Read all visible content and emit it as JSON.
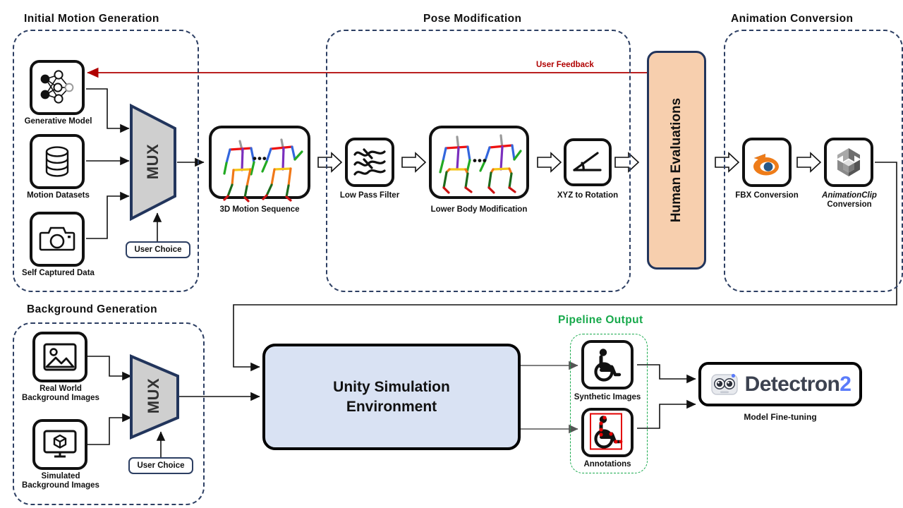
{
  "figure": {
    "title": "Synthetic wheelchair motion data generation pipeline",
    "sections": [
      {
        "id": "initial-motion-generation",
        "label": "Initial Motion Generation"
      },
      {
        "id": "pose-modification",
        "label": "Pose Modification"
      },
      {
        "id": "animation-conversion",
        "label": "Animation  Conversion"
      },
      {
        "id": "background-generation",
        "label": "Background  Generation"
      },
      {
        "id": "pipeline-output",
        "label": "Pipeline Output"
      }
    ],
    "colors": {
      "section_border": "#2d3f63",
      "pipeline_output": "#17a94b",
      "human_eval_fill": "#f7cfae",
      "human_eval_border": "#22355c",
      "unity_fill": "#d9e2f3",
      "feedback_arrow": "#b00000",
      "mux_fill": "#cfcfcf",
      "mux_border": "#22355c",
      "detectron_blue": "#5b7cfa",
      "annotation_box": "#e30000"
    }
  },
  "initial_motion": {
    "title": "Initial Motion Generation",
    "sources": [
      {
        "icon": "neural-network-icon",
        "label": "Generative Model"
      },
      {
        "icon": "database-icon",
        "label": "Motion Datasets"
      },
      {
        "icon": "camera-icon",
        "label": "Self Captured Data"
      }
    ],
    "mux_label": "MUX",
    "user_choice": "User Choice"
  },
  "motion_sequence": {
    "icon": "skeleton-sequence-icon",
    "label": "3D Motion Sequence",
    "ellipsis": "•••"
  },
  "pose_modification": {
    "title": "Pose Modification",
    "steps": [
      {
        "icon": "low-pass-filter-icon",
        "label": "Low Pass Filter"
      },
      {
        "icon": "skeleton-sequence-icon",
        "label": "Lower Body Modification",
        "ellipsis": "•••"
      },
      {
        "icon": "angle-icon",
        "label": "XYZ to Rotation"
      }
    ]
  },
  "human_evaluations": {
    "label": "Human Evaluations"
  },
  "feedback": {
    "label": "User Feedback"
  },
  "animation_conversion": {
    "title": "Animation  Conversion",
    "steps": [
      {
        "icon": "blender-icon",
        "label": "FBX Conversion",
        "label_italic": "",
        "label_rest": "FBX Conversion"
      },
      {
        "icon": "unity-cube-icon",
        "label": "AnimationClip Conversion",
        "label_italic": "AnimationClip",
        "label_rest": "Conversion"
      }
    ]
  },
  "background_generation": {
    "title": "Background  Generation",
    "sources": [
      {
        "icon": "image-icon",
        "label_line1": "Real World",
        "label_line2": "Background Images"
      },
      {
        "icon": "monitor-3d-icon",
        "label_line1": "Simulated",
        "label_line2": "Background Images"
      }
    ],
    "mux_label": "MUX",
    "user_choice": "User Choice"
  },
  "unity_simulation": {
    "line1": "Unity Simulation",
    "line2": "Environment"
  },
  "pipeline_output": {
    "title": "Pipeline Output",
    "items": [
      {
        "icon": "wheelchair-icon",
        "label": "Synthetic Images"
      },
      {
        "icon": "wheelchair-annotated-icon",
        "label": "Annotations"
      }
    ]
  },
  "model_finetuning": {
    "logo_icon": "detectron-robot-icon",
    "logo_text": "Detectron",
    "logo_suffix": "2",
    "label": "Model Fine-tuning"
  }
}
